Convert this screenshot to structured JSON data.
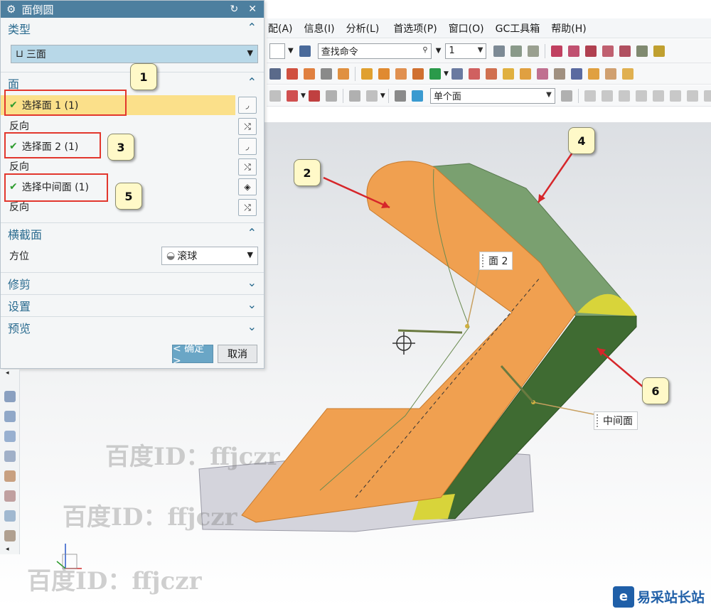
{
  "menu": [
    "配(A)",
    "信息(I)",
    "分析(L)",
    "首选项(P)",
    "窗口(O)",
    "GC工具箱",
    "帮助(H)"
  ],
  "toolbar": {
    "search_value": "查找命令",
    "layer_value": "1",
    "filter_value": "单个面"
  },
  "dialog": {
    "title": "面倒圆",
    "type_section": "类型",
    "type_value": "三面",
    "face_section": "面",
    "select_face1": "选择面 1 (1)",
    "reverse1": "反向",
    "select_face2": "选择面 2 (1)",
    "reverse2": "反向",
    "select_mid": "选择中间面 (1)",
    "reverse3": "反向",
    "cross_section": "横截面",
    "orientation_label": "方位",
    "orientation_value": "滚球",
    "trim_section": "修剪",
    "settings_section": "设置",
    "preview_section": "预览",
    "ok": "< 确定 >",
    "cancel": "取消"
  },
  "callouts": [
    "1",
    "2",
    "3",
    "4",
    "5",
    "6"
  ],
  "labels": {
    "face2": "面 2",
    "mid_face": "中间面"
  },
  "watermark": "百度ID：ffjczr",
  "brand": "易采站长站",
  "brand_logo": "e",
  "colors": {
    "orange_face": "#f0a050",
    "green_face": "#7aa070",
    "dark_green": "#3f6b32",
    "title_bar": "#4d7f9f",
    "selected_row": "#fbe08a",
    "red_box": "#e2372d"
  }
}
